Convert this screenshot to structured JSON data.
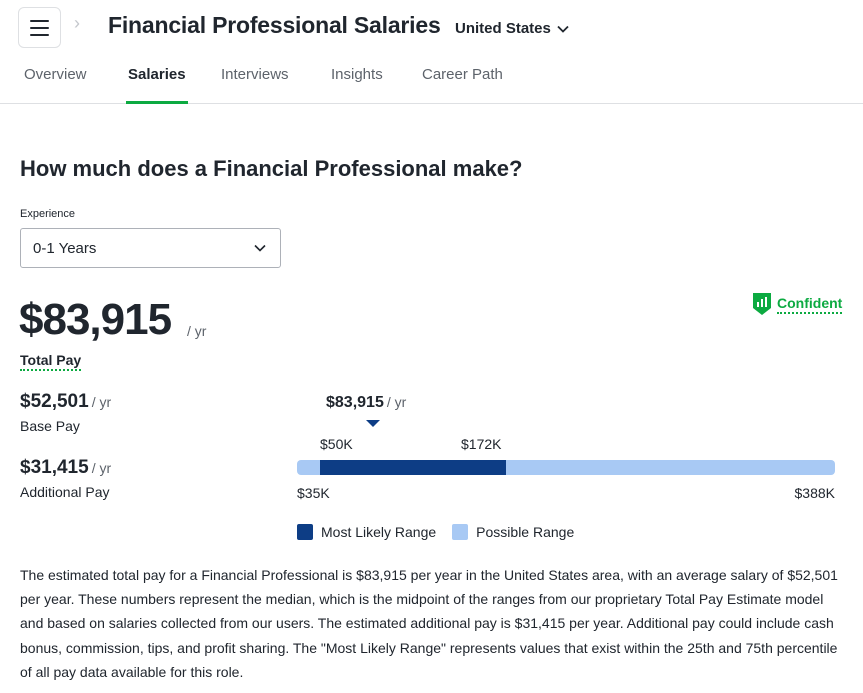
{
  "header": {
    "title": "Financial Professional Salaries",
    "location": "United States"
  },
  "tabs": [
    {
      "label": "Overview",
      "active": false
    },
    {
      "label": "Salaries",
      "active": true
    },
    {
      "label": "Interviews",
      "active": false
    },
    {
      "label": "Insights",
      "active": false
    },
    {
      "label": "Career Path",
      "active": false
    }
  ],
  "section": {
    "question": "How much does a Financial Professional make?",
    "experience_label": "Experience",
    "experience_value": "0-1 Years"
  },
  "pay": {
    "total": "$83,915",
    "unit": "/ yr",
    "total_label": "Total Pay",
    "confidence": "Confident",
    "base": "$52,501",
    "base_label": "Base Pay",
    "additional": "$31,415",
    "additional_label": "Additional Pay"
  },
  "chart_data": {
    "type": "range",
    "median_label": "$83,915",
    "median_unit": "/ yr",
    "median_value": 83915,
    "possible_range": {
      "min": 35000,
      "max": 388000,
      "min_label": "$35K",
      "max_label": "$388K"
    },
    "likely_range": {
      "min": 50000,
      "max": 172000,
      "min_label": "$50K",
      "max_label": "$172K"
    },
    "legend": [
      {
        "label": "Most Likely Range",
        "color": "#0d3d85"
      },
      {
        "label": "Possible Range",
        "color": "#a8c9f4"
      }
    ]
  },
  "description": "The estimated total pay for a Financial Professional is $83,915 per year in the United States area, with an average salary of $52,501 per year. These numbers represent the median, which is the midpoint of the ranges from our proprietary Total Pay Estimate model and based on salaries collected from our users. The estimated additional pay is $31,415 per year. Additional pay could include cash bonus, commission, tips, and profit sharing. The \"Most Likely Range\" represents values that exist within the 25th and 75th percentile of all pay data available for this role.",
  "colors": {
    "brand_green": "#0caa41",
    "likely_range": "#0d3d85",
    "possible_range": "#a8c9f4",
    "text": "#20262e"
  }
}
